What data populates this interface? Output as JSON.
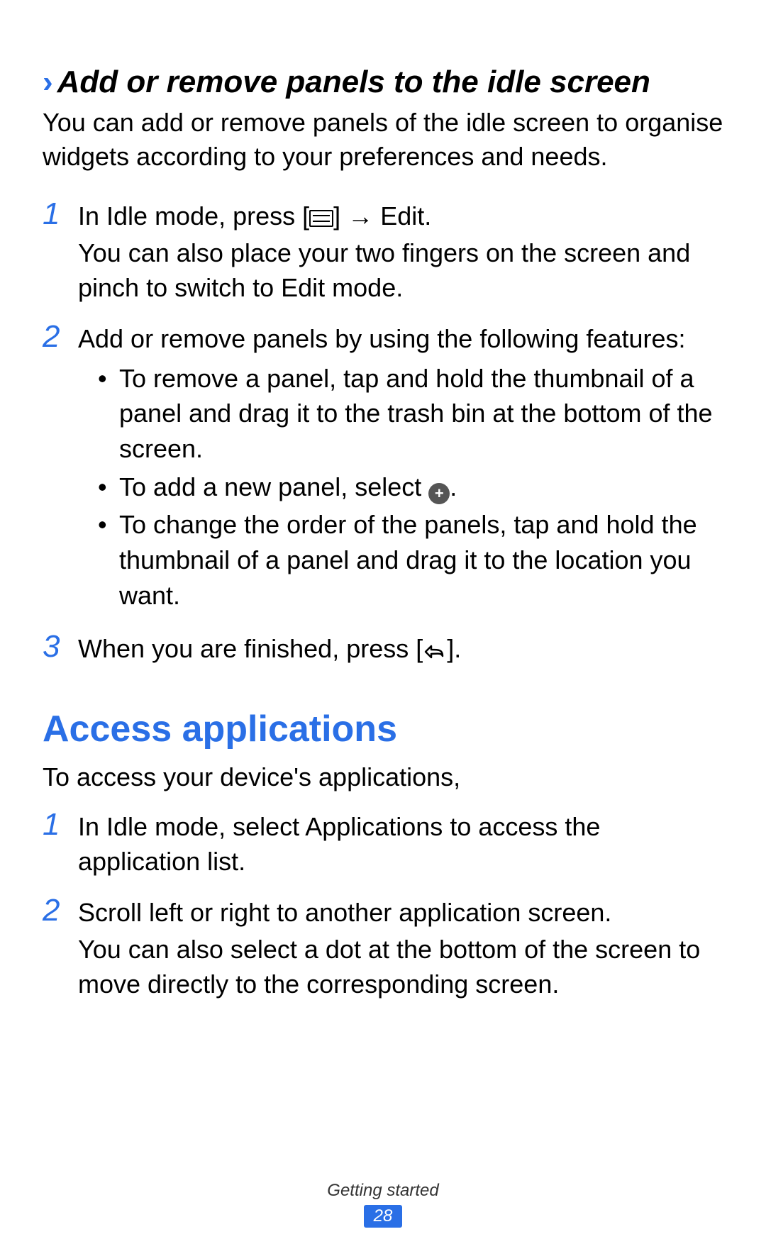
{
  "section1": {
    "heading": "Add or remove panels to the idle screen",
    "intro": "You can add or remove panels of the idle screen to organise widgets according to your preferences and needs.",
    "step1": {
      "prefix": "In Idle mode, press [",
      "mid": "] → ",
      "editWord": "Edit",
      "suffix": ".",
      "more": "You can also place your two fingers on the screen and pinch to switch to Edit mode."
    },
    "step2": {
      "lead": "Add or remove panels by using the following features:",
      "b1": "To remove a panel, tap and hold the thumbnail of a panel and drag it to the trash bin at the bottom of the screen.",
      "b2_pre": "To add a new panel, select ",
      "b2_post": ".",
      "b3": "To change the order of the panels, tap and hold the thumbnail of a panel and drag it to the location you want."
    },
    "step3": {
      "pre": "When you are finished, press [",
      "post": "]."
    }
  },
  "section2": {
    "heading": "Access applications",
    "intro": "To access your device's applications,",
    "step1": {
      "pre": "In Idle mode, select ",
      "appWord": "Applications",
      "post": " to access the application list."
    },
    "step2": {
      "line1": "Scroll left or right to another application screen.",
      "more": "You can also select a dot at the bottom of the screen to move directly to the corresponding screen."
    }
  },
  "footer": {
    "chapter": "Getting started",
    "page": "28"
  }
}
